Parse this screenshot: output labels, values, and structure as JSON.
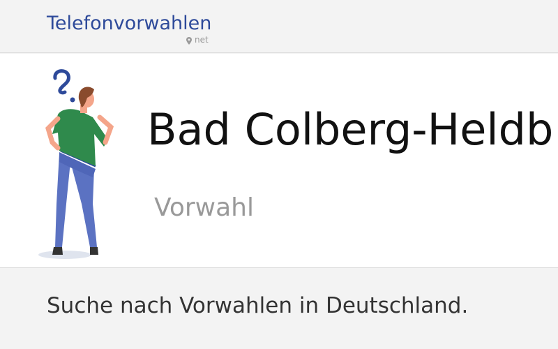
{
  "header": {
    "logo_title": "Telefonvorwahlen",
    "logo_sub": "net"
  },
  "hero": {
    "place_title": "Bad Colberg-Heldb",
    "subtitle": "Vorwahl"
  },
  "search": {
    "heading": "Suche nach Vorwahlen in Deutschland."
  },
  "colors": {
    "brand": "#2e4a9a",
    "shirt": "#2f8a4c",
    "pants": "#5b72c2",
    "question_mark": "#2e4a9a"
  },
  "icons": {
    "logo_pin": "map-pin-icon",
    "illustration": "thinking-person-illustration"
  }
}
